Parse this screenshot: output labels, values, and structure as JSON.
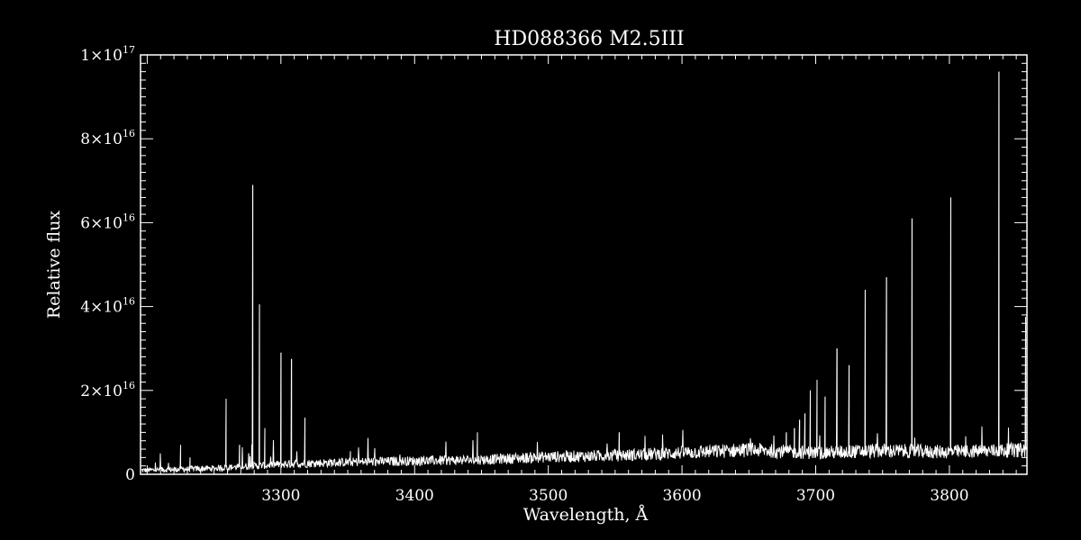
{
  "chart_data": {
    "type": "line",
    "title": "HD088366   M2.5III",
    "xlabel": "Wavelength, Å",
    "ylabel": "Relative flux",
    "xlim": [
      3195,
      3858
    ],
    "ylim": [
      0,
      1e+17
    ],
    "x_ticks": [
      3300,
      3400,
      3500,
      3600,
      3700,
      3800
    ],
    "x_tick_labels": [
      "3300",
      "3400",
      "3500",
      "3600",
      "3700",
      "3800"
    ],
    "y_ticks": [
      {
        "value": 0,
        "mantissa": "0",
        "exp": ""
      },
      {
        "value": 2e+16,
        "mantissa": "2×10",
        "exp": "16"
      },
      {
        "value": 4e+16,
        "mantissa": "4×10",
        "exp": "16"
      },
      {
        "value": 6e+16,
        "mantissa": "6×10",
        "exp": "16"
      },
      {
        "value": 8e+16,
        "mantissa": "8×10",
        "exp": "16"
      },
      {
        "value": 1e+17,
        "mantissa": "1×10",
        "exp": "17"
      }
    ],
    "continuum": [
      [
        3195,
        1000000000000000.0
      ],
      [
        3250,
        1500000000000000.0
      ],
      [
        3300,
        2500000000000000.0
      ],
      [
        3350,
        3000000000000000.0
      ],
      [
        3400,
        3300000000000000.0
      ],
      [
        3450,
        3600000000000000.0
      ],
      [
        3500,
        4300000000000000.0
      ],
      [
        3550,
        4600000000000000.0
      ],
      [
        3600,
        5300000000000000.0
      ],
      [
        3650,
        6000000000000000.0
      ],
      [
        3700,
        5300000000000000.0
      ],
      [
        3750,
        5800000000000000.0
      ],
      [
        3800,
        5500000000000000.0
      ],
      [
        3858,
        6000000000000000.0
      ]
    ],
    "spikes": [
      {
        "x": 3225,
        "y": 7000000000000000.0
      },
      {
        "x": 3232,
        "y": 4000000000000000.0
      },
      {
        "x": 3259,
        "y": 1.8e+16
      },
      {
        "x": 3269,
        "y": 7000000000000000.0
      },
      {
        "x": 3276,
        "y": 5000000000000000.0
      },
      {
        "x": 3279,
        "y": 6.9e+16
      },
      {
        "x": 3284,
        "y": 4.05e+16
      },
      {
        "x": 3288,
        "y": 1.1e+16
      },
      {
        "x": 3300,
        "y": 2.9e+16
      },
      {
        "x": 3308,
        "y": 2.75e+16
      },
      {
        "x": 3318,
        "y": 1.35e+16
      },
      {
        "x": 3352,
        "y": 5500000000000000.0
      },
      {
        "x": 3447,
        "y": 1e+16
      },
      {
        "x": 3553,
        "y": 1e+16
      },
      {
        "x": 3678,
        "y": 1e+16
      },
      {
        "x": 3684,
        "y": 1.1e+16
      },
      {
        "x": 3688,
        "y": 1.3e+16
      },
      {
        "x": 3692,
        "y": 1.45e+16
      },
      {
        "x": 3696,
        "y": 2e+16
      },
      {
        "x": 3701,
        "y": 2.25e+16
      },
      {
        "x": 3707,
        "y": 1.85e+16
      },
      {
        "x": 3716,
        "y": 3e+16
      },
      {
        "x": 3725,
        "y": 2.6e+16
      },
      {
        "x": 3737,
        "y": 4.4e+16
      },
      {
        "x": 3753,
        "y": 4.7e+16
      },
      {
        "x": 3772,
        "y": 6.1e+16
      },
      {
        "x": 3801,
        "y": 6.6e+16
      },
      {
        "x": 3837,
        "y": 9.6e+16
      },
      {
        "x": 3857,
        "y": 3.75e+16
      }
    ]
  }
}
